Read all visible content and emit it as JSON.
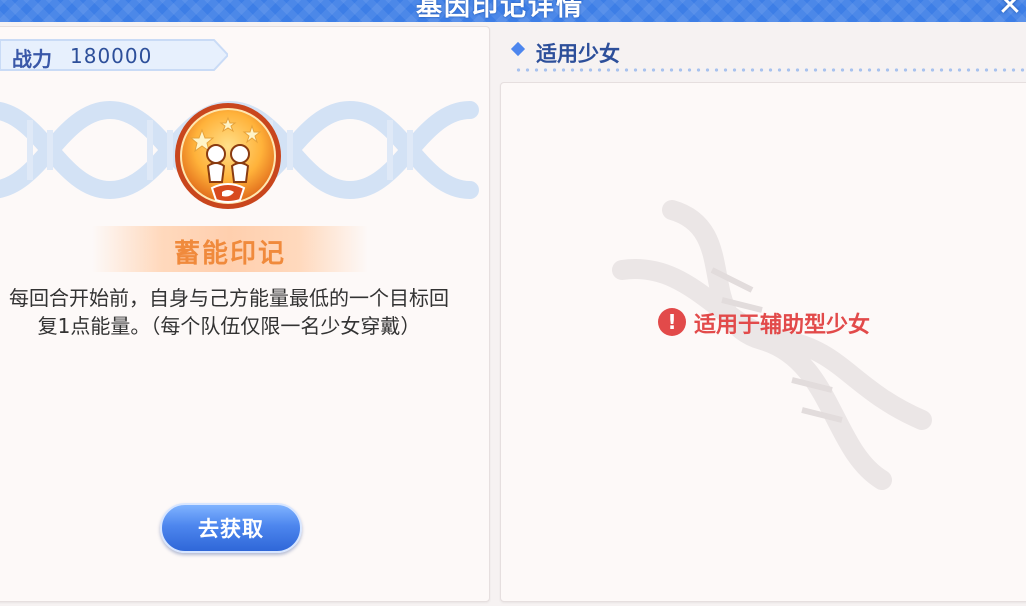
{
  "window": {
    "title": "基因印记详情",
    "close_icon": "close-icon"
  },
  "left_panel": {
    "power": {
      "label": "战力",
      "value": "180000"
    },
    "imprint": {
      "name": "蓄能印记",
      "emblem_icon": "energy-imprint-emblem-icon",
      "description": "每回合开始前，自身与己方能量最低的一个目标回复1点能量。（每个队伍仅限一名少女穿戴）"
    },
    "get_button": "去获取"
  },
  "right_panel": {
    "section_title": "适用少女",
    "notice": "适用于辅助型少女",
    "notice_icon": "warning-icon"
  },
  "colors": {
    "title_bar": "#3d7ee6",
    "accent_blue": "#2d4f9a",
    "name_orange": "#f08a3c",
    "warning_red": "#e24a4a"
  }
}
